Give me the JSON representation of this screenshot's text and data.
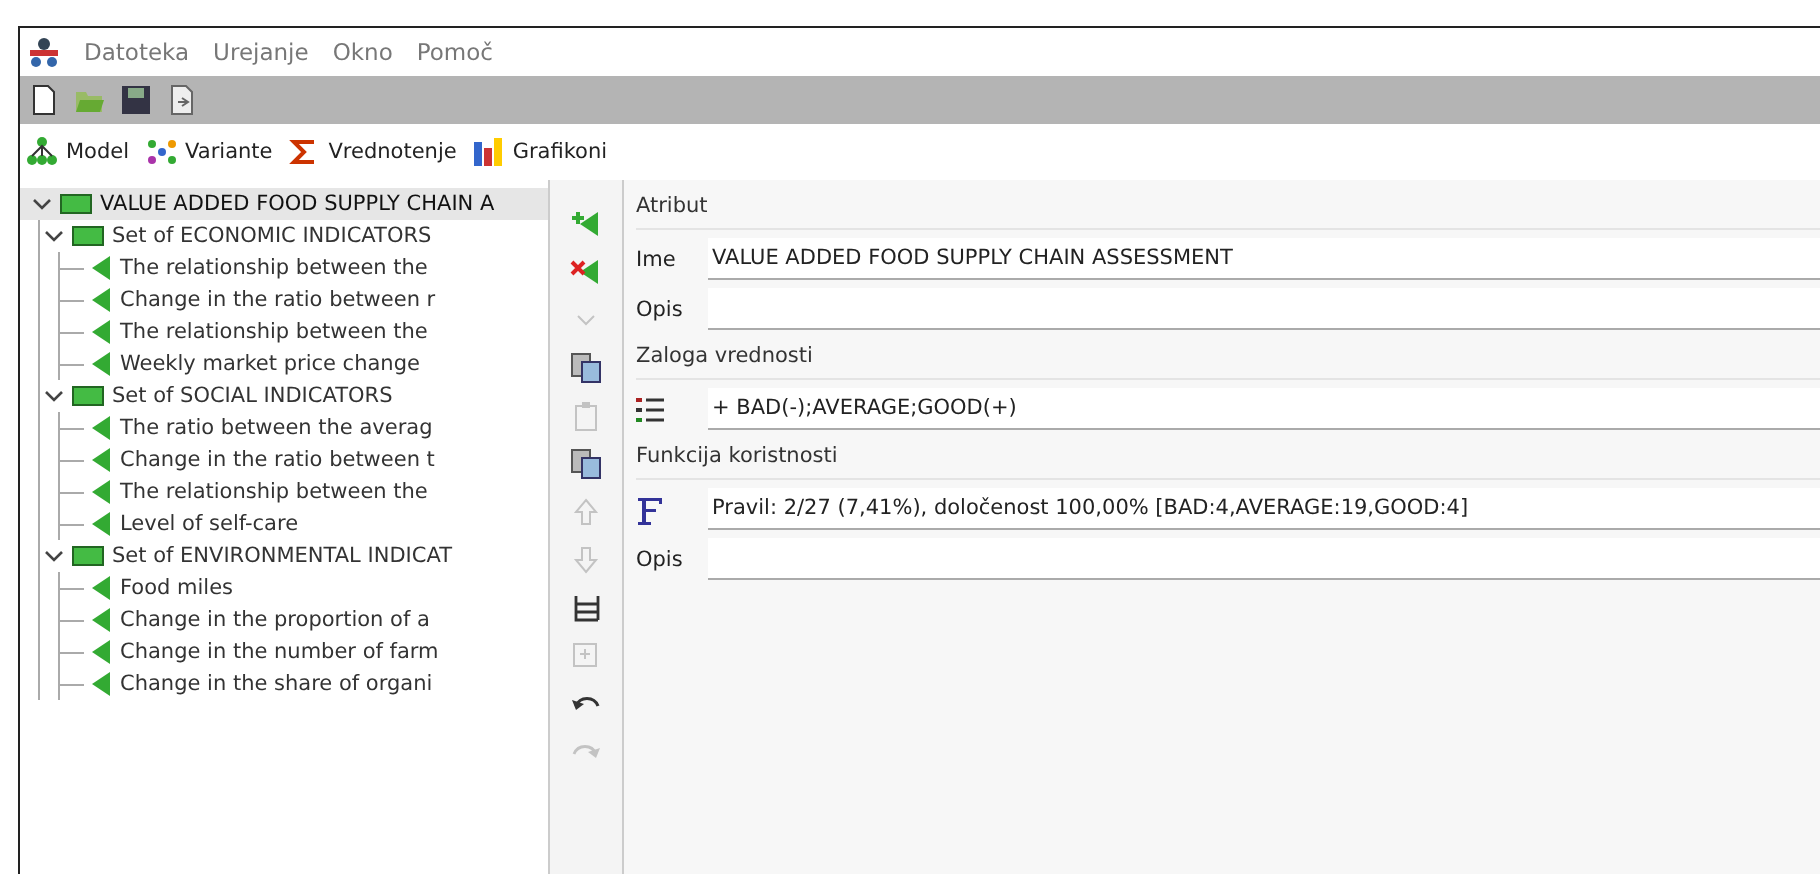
{
  "menu": [
    {
      "label": "Datoteka"
    },
    {
      "label": "Urejanje"
    },
    {
      "label": "Okno"
    },
    {
      "label": "Pomoč"
    }
  ],
  "toolbar": [
    {
      "kind": "new"
    },
    {
      "kind": "open"
    },
    {
      "kind": "save"
    },
    {
      "kind": "export"
    }
  ],
  "tabs": [
    {
      "label": "Model",
      "kind": "tree"
    },
    {
      "label": "Variante",
      "kind": "dots"
    },
    {
      "label": "Vrednotenje",
      "kind": "sigma"
    },
    {
      "label": "Grafikoni",
      "kind": "chart"
    }
  ],
  "tree": [
    {
      "label": "VALUE ADDED FOOD SUPPLY CHAIN A",
      "selected": true,
      "expanded": true,
      "children": [
        {
          "label": "Set of ECONOMIC INDICATORS",
          "selected": false,
          "expanded": true,
          "children": [
            {
              "label": "The relationship between the",
              "selected": false
            },
            {
              "label": "Change in the ratio between r",
              "selected": false
            },
            {
              "label": "The relationship between the",
              "selected": false
            },
            {
              "label": "Weekly market price change",
              "selected": false
            }
          ]
        },
        {
          "label": "Set of SOCIAL INDICATORS",
          "selected": false,
          "expanded": true,
          "children": [
            {
              "label": "The ratio between the averag",
              "selected": false
            },
            {
              "label": "Change in the ratio between t",
              "selected": false
            },
            {
              "label": "The relationship between the",
              "selected": false
            },
            {
              "label": "Level of self-care",
              "selected": false
            }
          ]
        },
        {
          "label": "Set of ENVIRONMENTAL INDICAT",
          "selected": false,
          "expanded": true,
          "children": [
            {
              "label": "Food miles",
              "selected": false
            },
            {
              "label": "Change in the proportion of a",
              "selected": false
            },
            {
              "label": "Change in the number of farm",
              "selected": false
            },
            {
              "label": "Change in the share of organi",
              "selected": false
            }
          ]
        }
      ]
    }
  ],
  "tools": [
    {
      "kind": "add",
      "disabled": false
    },
    {
      "kind": "delete",
      "disabled": false
    },
    {
      "kind": "chevron",
      "disabled": true
    },
    {
      "kind": "copy",
      "disabled": false
    },
    {
      "kind": "paste",
      "disabled": true
    },
    {
      "kind": "copy",
      "disabled": false
    },
    {
      "kind": "up",
      "disabled": true
    },
    {
      "kind": "down",
      "disabled": true
    },
    {
      "kind": "structure",
      "disabled": false
    },
    {
      "kind": "expand",
      "disabled": true
    },
    {
      "kind": "undo",
      "disabled": false
    },
    {
      "kind": "redo",
      "disabled": true
    }
  ],
  "sections": [
    {
      "title": "Atribut",
      "rows": [
        {
          "kind": "label",
          "label": "Ime",
          "value": "VALUE ADDED FOOD SUPPLY CHAIN ASSESSMENT"
        },
        {
          "kind": "label",
          "label": "Opis",
          "value": ""
        }
      ]
    },
    {
      "title": "Zaloga vrednosti",
      "rows": [
        {
          "kind": "list",
          "value": "+ BAD(-);AVERAGE;GOOD(+)"
        }
      ]
    },
    {
      "title": "Funkcija koristnosti",
      "rows": [
        {
          "kind": "function",
          "value": "Pravil: 2/27 (7,41%), določenost 100,00% [BAD:4,AVERAGE:19,GOOD:4]"
        },
        {
          "kind": "label",
          "label": "Opis",
          "value": ""
        }
      ]
    }
  ]
}
